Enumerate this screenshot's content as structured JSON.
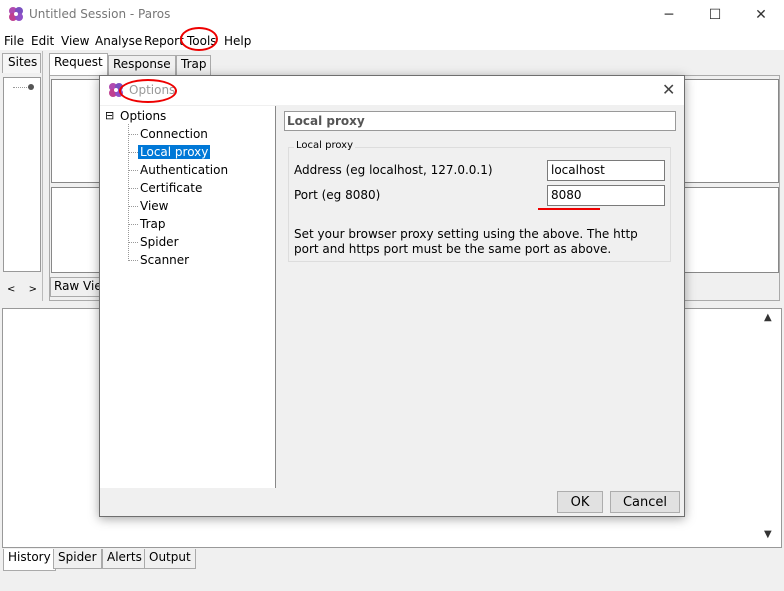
{
  "window": {
    "title": "Untitled Session - Paros",
    "minimize": "─",
    "maximize": "☐",
    "close": "✕"
  },
  "menu": [
    "File",
    "Edit",
    "View",
    "Analyse",
    "Report",
    "Tools",
    "Help"
  ],
  "sites": {
    "tab_label": "Sites",
    "scroll_left": "<",
    "scroll_right": ">"
  },
  "main_tabs": [
    "Request",
    "Response",
    "Trap"
  ],
  "raw_view_tab": "Raw View",
  "bottom_tabs": [
    "History",
    "Spider",
    "Alerts",
    "Output"
  ],
  "scroll": {
    "up": "▲",
    "down": "▼"
  },
  "dialog": {
    "title": "Options",
    "close": "✕",
    "tree": {
      "root": "Options",
      "expander": "⊟",
      "children": [
        "Connection",
        "Local proxy",
        "Authentication",
        "Certificate",
        "View",
        "Trap",
        "Spider",
        "Scanner"
      ],
      "selected": "Local proxy"
    },
    "section_title": "Local proxy",
    "group_label": "Local proxy",
    "address_label": "Address (eg localhost, 127.0.0.1)",
    "address_value": "localhost",
    "port_label": "Port (eg 8080)",
    "port_value": "8080",
    "hint": "Set your browser proxy setting using the above.  The http port and https port must be the same port as above.",
    "ok": "OK",
    "cancel": "Cancel"
  },
  "colors": {
    "annotation": "#e00000",
    "selection": "#0078d7"
  }
}
